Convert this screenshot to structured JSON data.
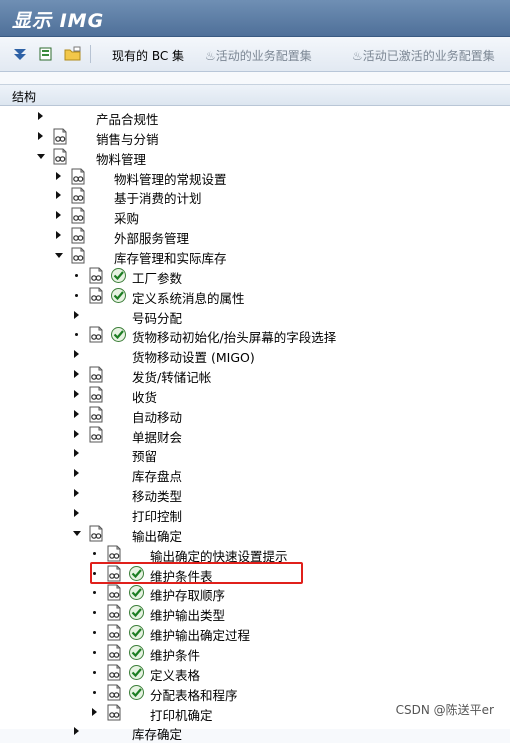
{
  "title": "显示 IMG",
  "toolbar": {
    "existing_bc_sets": "现有的 BC 集",
    "active_bc_sets": "活动的业务配置集",
    "activated_bc_sets": "活动已激活的业务配置集"
  },
  "tree_header": "结构",
  "tree_rows": [
    {
      "label": "产品合规性",
      "level": 0,
      "expander": "right",
      "icon": false,
      "check": false
    },
    {
      "label": "销售与分销",
      "level": 0,
      "expander": "right",
      "icon": true,
      "check": false
    },
    {
      "label": "物料管理",
      "level": 0,
      "expander": "down",
      "icon": true,
      "check": false
    },
    {
      "label": "物料管理的常规设置",
      "level": 1,
      "expander": "right",
      "icon": true,
      "check": false
    },
    {
      "label": "基于消费的计划",
      "level": 1,
      "expander": "right",
      "icon": true,
      "check": false
    },
    {
      "label": "采购",
      "level": 1,
      "expander": "right",
      "icon": true,
      "check": false
    },
    {
      "label": "外部服务管理",
      "level": 1,
      "expander": "right",
      "icon": true,
      "check": false
    },
    {
      "label": "库存管理和实际库存",
      "level": 1,
      "expander": "down",
      "icon": true,
      "check": false
    },
    {
      "label": "工厂参数",
      "level": 2,
      "expander": "dot",
      "icon": true,
      "check": true
    },
    {
      "label": "定义系统消息的属性",
      "level": 2,
      "expander": "dot",
      "icon": true,
      "check": true
    },
    {
      "label": "号码分配",
      "level": 2,
      "expander": "right",
      "icon": false,
      "check": false
    },
    {
      "label": "货物移动初始化/抬头屏幕的字段选择",
      "level": 2,
      "expander": "dot",
      "icon": true,
      "check": true
    },
    {
      "label": "货物移动设置 (MIGO)",
      "level": 2,
      "expander": "right",
      "icon": false,
      "check": false
    },
    {
      "label": "发货/转储记帐",
      "level": 2,
      "expander": "right",
      "icon": true,
      "check": false
    },
    {
      "label": "收货",
      "level": 2,
      "expander": "right",
      "icon": true,
      "check": false
    },
    {
      "label": "自动移动",
      "level": 2,
      "expander": "right",
      "icon": true,
      "check": false
    },
    {
      "label": "单据财会",
      "level": 2,
      "expander": "right",
      "icon": true,
      "check": false
    },
    {
      "label": "预留",
      "level": 2,
      "expander": "right",
      "icon": false,
      "check": false
    },
    {
      "label": "库存盘点",
      "level": 2,
      "expander": "right",
      "icon": false,
      "check": false
    },
    {
      "label": "移动类型",
      "level": 2,
      "expander": "right",
      "icon": false,
      "check": false
    },
    {
      "label": "打印控制",
      "level": 2,
      "expander": "right",
      "icon": false,
      "check": false
    },
    {
      "label": "输出确定",
      "level": 2,
      "expander": "down",
      "icon": true,
      "check": false
    },
    {
      "label": "输出确定的快速设置提示",
      "level": 3,
      "expander": "dot",
      "icon": true,
      "check": false
    },
    {
      "label": "维护条件表",
      "level": 3,
      "expander": "dot",
      "icon": true,
      "check": true
    },
    {
      "label": "维护存取顺序",
      "level": 3,
      "expander": "dot",
      "icon": true,
      "check": true
    },
    {
      "label": "维护输出类型",
      "level": 3,
      "expander": "dot",
      "icon": true,
      "check": true
    },
    {
      "label": "维护输出确定过程",
      "level": 3,
      "expander": "dot",
      "icon": true,
      "check": true
    },
    {
      "label": "维护条件",
      "level": 3,
      "expander": "dot",
      "icon": true,
      "check": true
    },
    {
      "label": "定义表格",
      "level": 3,
      "expander": "dot",
      "icon": true,
      "check": true
    },
    {
      "label": "分配表格和程序",
      "level": 3,
      "expander": "dot",
      "icon": true,
      "check": true
    },
    {
      "label": "打印机确定",
      "level": 3,
      "expander": "right",
      "icon": true,
      "check": false
    },
    {
      "label": "库存确定",
      "level": 2,
      "expander": "right",
      "icon": false,
      "check": false
    }
  ],
  "highlighted_row": "维护条件表",
  "watermark": "CSDN @陈送平er"
}
